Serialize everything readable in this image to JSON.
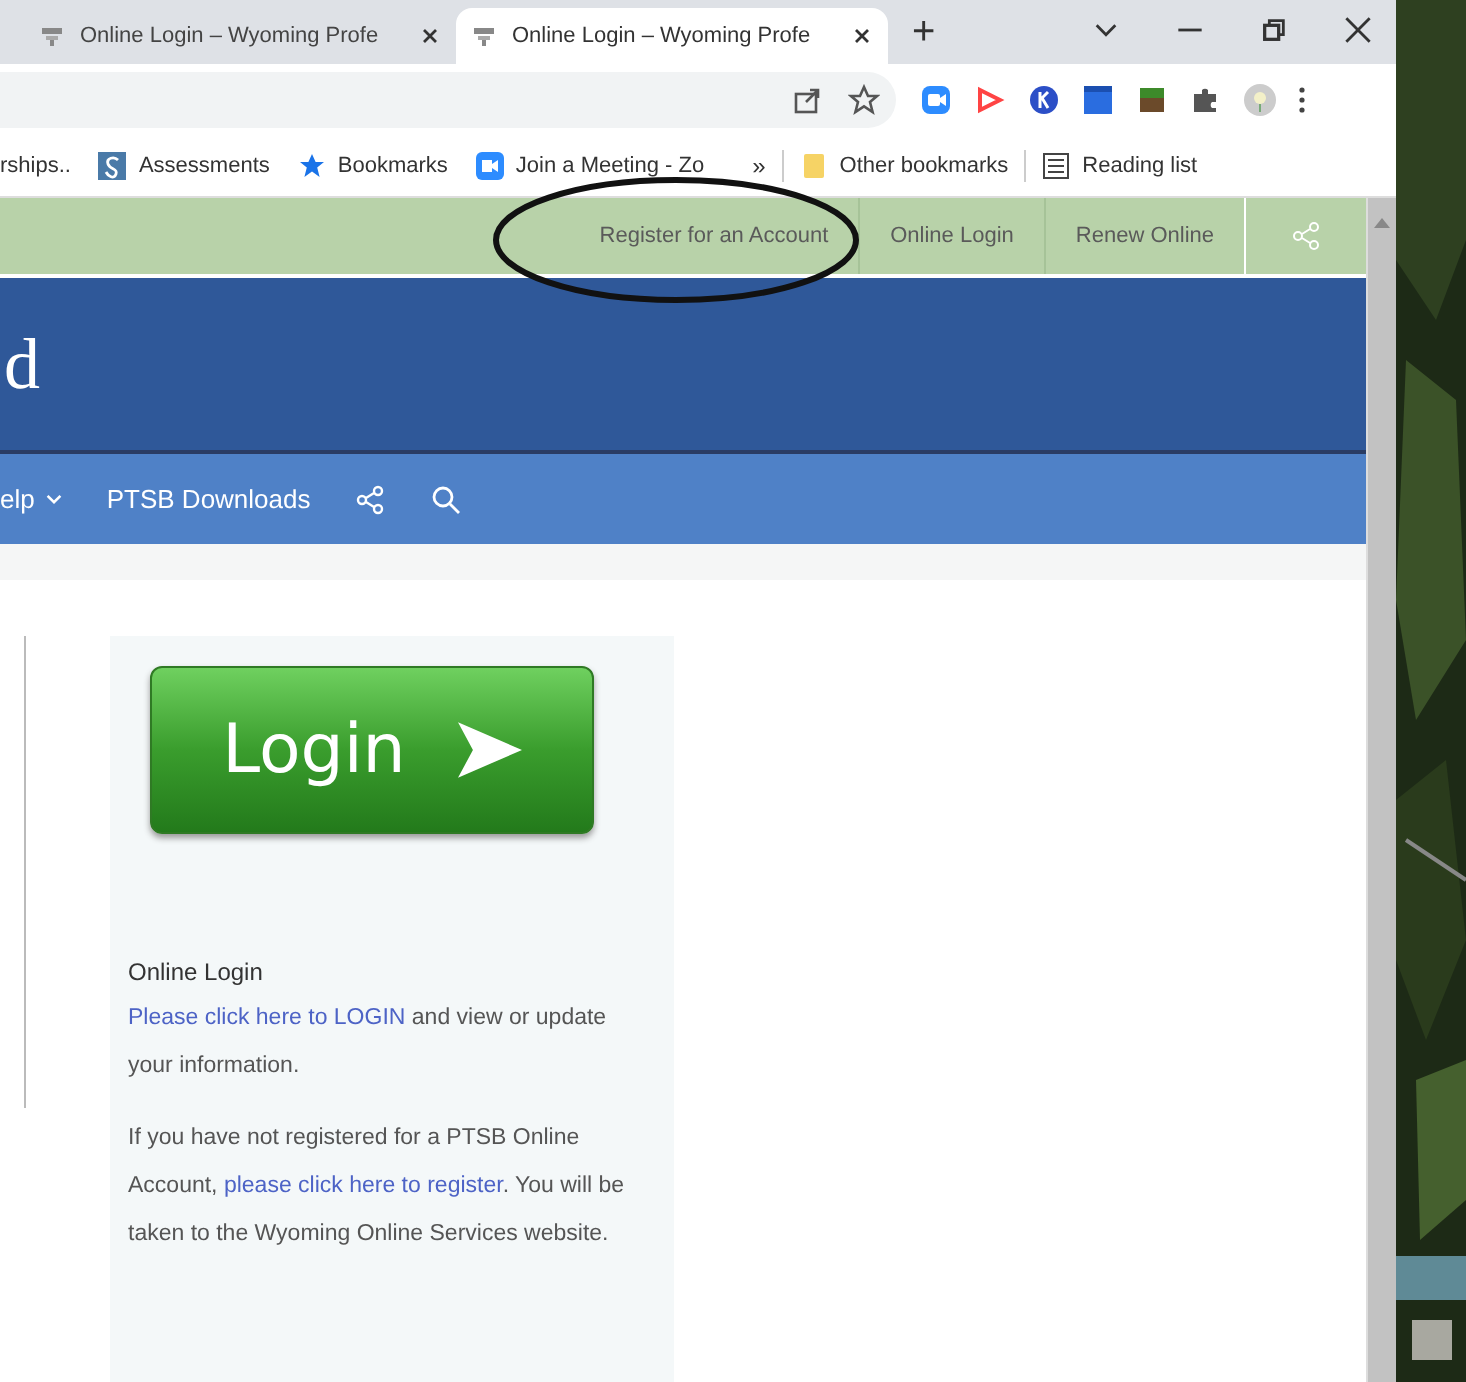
{
  "tabs": [
    {
      "title": "Online Login – Wyoming Profe",
      "selected": false
    },
    {
      "title": "Online Login – Wyoming Profe",
      "selected": true
    }
  ],
  "new_tab": "+",
  "bookmarks": [
    {
      "kind": "text",
      "label": "rships.."
    },
    {
      "kind": "s",
      "label": "Assessments"
    },
    {
      "kind": "star",
      "label": "Bookmarks"
    },
    {
      "kind": "video",
      "label": "Join a Meeting - Zo"
    }
  ],
  "more_bookmarks": "»",
  "other_bookmarks": "Other bookmarks",
  "reading_list": "Reading list",
  "top_links": [
    "Register for an Account",
    "Online Login",
    "Renew Online"
  ],
  "site_title": "d",
  "nav": [
    {
      "label": "elp",
      "dropdown": true
    },
    {
      "label": "PTSB Downloads",
      "dropdown": false
    }
  ],
  "login_button": "Login",
  "card_heading": "Online Login",
  "paragraphs": [
    [
      {
        "text": "Please click here to LOGIN",
        "link": true
      },
      {
        "text": " and view or update your information.",
        "link": false
      }
    ],
    [
      {
        "text": "If you have not registered for a PTSB Online Account, ",
        "link": false
      },
      {
        "text": "please click here to register",
        "link": true
      },
      {
        "text": ". You will be taken to the Wyoming Online Services website.",
        "link": false
      }
    ]
  ]
}
